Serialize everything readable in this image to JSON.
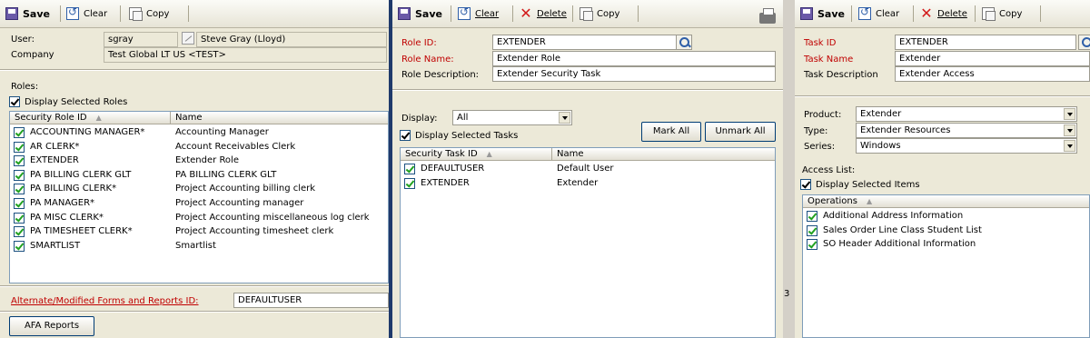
{
  "win1": {
    "toolbar": {
      "save": "Save",
      "clear": "Clear",
      "copy": "Copy"
    },
    "user_label": "User:",
    "user_value": "sgray",
    "user_name": "Steve Gray (Lloyd)",
    "company_label": "Company",
    "company_value": "Test Global LT US <TEST>",
    "roles_label": "Roles:",
    "display_selected": "Display Selected Roles",
    "grid": {
      "col1": "Security Role ID",
      "col2": "Name",
      "rows": [
        {
          "id": "ACCOUNTING MANAGER*",
          "name": "Accounting Manager"
        },
        {
          "id": "AR CLERK*",
          "name": "Account Receivables Clerk"
        },
        {
          "id": "EXTENDER",
          "name": "Extender Role"
        },
        {
          "id": "PA BILLING CLERK GLT",
          "name": "PA BILLING CLERK GLT"
        },
        {
          "id": "PA BILLING CLERK*",
          "name": "Project Accounting billing clerk"
        },
        {
          "id": "PA MANAGER*",
          "name": "Project Accounting manager"
        },
        {
          "id": "PA MISC CLERK*",
          "name": "Project Accounting miscellaneous log clerk"
        },
        {
          "id": "PA TIMESHEET CLERK*",
          "name": "Project Accounting timesheet clerk"
        },
        {
          "id": "SMARTLIST",
          "name": "Smartlist"
        }
      ]
    },
    "alt_forms_label": "Alternate/Modified Forms and Reports ID:",
    "alt_forms_value": "DEFAULTUSER",
    "afa_button": "AFA Reports"
  },
  "win2": {
    "toolbar": {
      "save": "Save",
      "clear": "Clear",
      "delete": "Delete",
      "copy": "Copy"
    },
    "role_id_label": "Role ID:",
    "role_id_value": "EXTENDER",
    "role_name_label": "Role Name:",
    "role_name_value": "Extender Role",
    "role_desc_label": "Role Description:",
    "role_desc_value": "Extender Security Task",
    "display_label": "Display:",
    "display_value": "All",
    "mark_all": "Mark All",
    "unmark_all": "Unmark All",
    "display_selected": "Display Selected Tasks",
    "grid": {
      "col1": "Security Task ID",
      "col2": "Name",
      "rows": [
        {
          "id": "DEFAULTUSER",
          "name": "Default User"
        },
        {
          "id": "EXTENDER",
          "name": "Extender"
        }
      ]
    }
  },
  "gutter_digit": "3",
  "win3": {
    "toolbar": {
      "save": "Save",
      "clear": "Clear",
      "delete": "Delete",
      "copy": "Copy"
    },
    "task_id_label": "Task ID",
    "task_id_value": "EXTENDER",
    "task_name_label": "Task Name",
    "task_name_value": "Extender",
    "task_desc_label": "Task Description",
    "task_desc_value": "Extender Access",
    "product_label": "Product:",
    "product_value": "Extender",
    "type_label": "Type:",
    "type_value": "Extender Resources",
    "series_label": "Series:",
    "series_value": "Windows",
    "access_list_label": "Access List:",
    "display_selected": "Display Selected Items",
    "grid": {
      "col1": "Operations",
      "rows": [
        {
          "name": "Additional Address Information"
        },
        {
          "name": "Sales Order Line Class Student List"
        },
        {
          "name": "SO Header Additional Information"
        }
      ]
    }
  },
  "colors": {
    "required_label": "#c00000",
    "background": "#ece9d8",
    "desktop": "#1f3a6b"
  }
}
